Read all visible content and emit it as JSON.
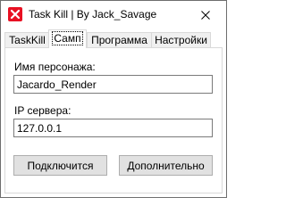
{
  "window": {
    "title": "Task Kill | By Jack_Savage",
    "app_icon": "red-white-cross-icon",
    "close_icon": "close-icon"
  },
  "tabs": [
    {
      "label": "TaskKill",
      "active": false
    },
    {
      "label": "Самп",
      "active": true
    },
    {
      "label": "Программа",
      "active": false
    },
    {
      "label": "Настройки",
      "active": false
    }
  ],
  "form": {
    "nickname_label": "Имя персонажа:",
    "nickname_value": "Jacardo_Render",
    "ip_label": "IP сервера:",
    "ip_value": "127.0.0.1"
  },
  "buttons": {
    "connect_label": "Подключится",
    "advanced_label": "Дополнительно"
  },
  "colors": {
    "icon_red": "#e81123",
    "window_border": "#6e6e6e",
    "tab_border": "#d9d9d9",
    "button_face": "#e1e1e1",
    "button_border": "#adadad"
  }
}
